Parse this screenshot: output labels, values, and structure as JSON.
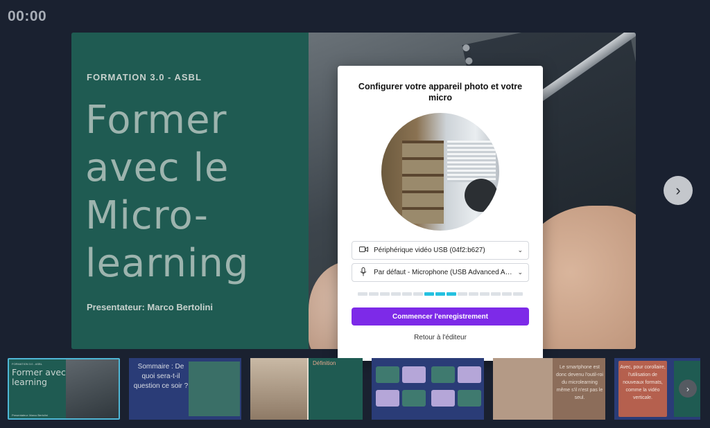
{
  "timer": "00:00",
  "slide": {
    "kicker": "FORMATION 3.0 - ASBL",
    "title": "Former avec le Micro-learning",
    "presenter": "Presentateur: Marco Bertolini"
  },
  "modal": {
    "title": "Configurer votre appareil photo et votre micro",
    "camera_select": "Périphérique vidéo USB (04f2:b627)",
    "mic_select": "Par défaut - Microphone (USB Advanced Audi...",
    "audio_level_segments": 15,
    "audio_level_active": [
      6,
      7,
      8
    ],
    "record_button": "Commencer l'enregistrement",
    "back_link": "Retour à l'éditeur"
  },
  "thumbnails": [
    {
      "title": "Former avec le Micro-learning",
      "kicker": "FORMATION 3.0 - ASBL",
      "presenter": "Presentateur: Marco Bertolini",
      "selected": true
    },
    {
      "text": "Sommaire : De quoi sera-t-il question ce soir ?"
    },
    {
      "heading": "Définition"
    },
    {
      "heading": ""
    },
    {
      "text": "Le smartphone est donc devenu l'outil-roi du microlearning même s'il n'est pas le seul."
    },
    {
      "text": "Avec, pour corollaire, l'utilisation de nouveaux formats, comme la vidéo verticale."
    }
  ],
  "icons": {
    "next": "chevron-right-icon",
    "camera": "video-camera-icon",
    "mic": "microphone-icon"
  },
  "colors": {
    "accent": "#7d2ae8",
    "meter_active": "#25c1e0",
    "slide_bg": "#1f5b52"
  }
}
